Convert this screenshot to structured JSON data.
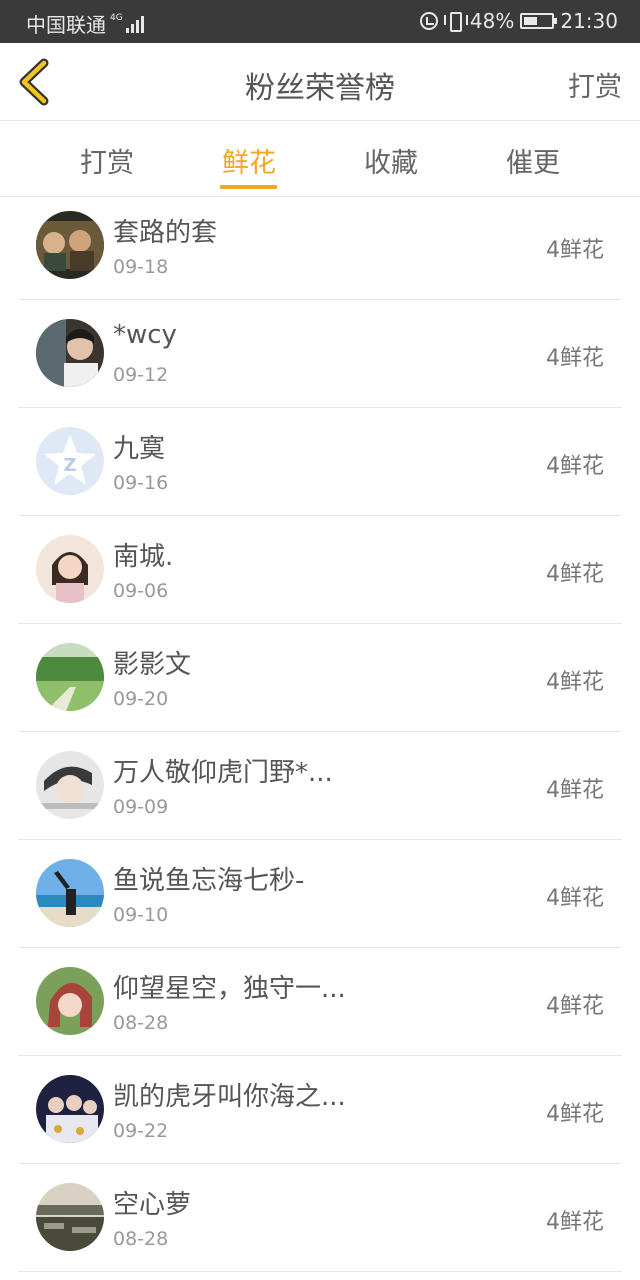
{
  "status_bar": {
    "carrier": "中国联通",
    "network": "4G",
    "battery": "48%",
    "time": "21:30"
  },
  "header": {
    "title": "粉丝荣誉榜",
    "action": "打赏"
  },
  "tabs": [
    {
      "label": "打赏",
      "active": false
    },
    {
      "label": "鲜花",
      "active": true
    },
    {
      "label": "收藏",
      "active": false
    },
    {
      "label": "催更",
      "active": false
    }
  ],
  "colors": {
    "accent": "#f5a523",
    "status_bar": "#3a3a3a",
    "divider": "#e6e6e6"
  },
  "fans": [
    {
      "name": "套路的套",
      "date": "09-18",
      "amount": "4鲜花"
    },
    {
      "name": "*wcy",
      "date": "09-12",
      "amount": "4鲜花"
    },
    {
      "name": "九寞",
      "date": "09-16",
      "amount": "4鲜花"
    },
    {
      "name": "南城.",
      "date": "09-06",
      "amount": "4鲜花"
    },
    {
      "name": "影影文",
      "date": "09-20",
      "amount": "4鲜花"
    },
    {
      "name": "万人敬仰虎门野*...",
      "date": "09-09",
      "amount": "4鲜花"
    },
    {
      "name": "鱼说鱼忘海七秒-",
      "date": "09-10",
      "amount": "4鲜花"
    },
    {
      "name": "仰望星空，独守一...",
      "date": "08-28",
      "amount": "4鲜花"
    },
    {
      "name": "凯的虎牙叫你海之...",
      "date": "09-22",
      "amount": "4鲜花"
    },
    {
      "name": "空心萝",
      "date": "08-28",
      "amount": "4鲜花"
    }
  ]
}
